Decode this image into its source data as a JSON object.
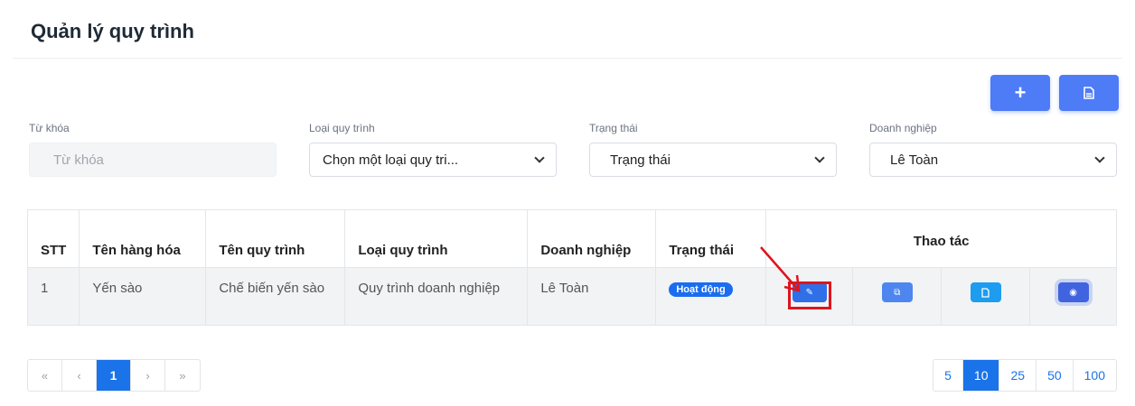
{
  "page": {
    "title": "Quản lý quy trình"
  },
  "actions": {
    "add_icon": "plus-icon",
    "export_icon": "document-icon"
  },
  "filters": {
    "keyword": {
      "label": "Từ khóa",
      "placeholder": "Từ khóa"
    },
    "process_type": {
      "label": "Loại quy trình",
      "value": "Chọn một loại quy tri..."
    },
    "status": {
      "label": "Trạng thái",
      "value": "Trạng thái"
    },
    "company": {
      "label": "Doanh nghiệp",
      "value": "Lê Toàn"
    }
  },
  "table": {
    "headers": {
      "index": "STT",
      "product": "Tên hàng hóa",
      "process_name": "Tên quy trình",
      "process_type": "Loại quy trình",
      "company": "Doanh nghiệp",
      "status": "Trạng thái",
      "actions": "Thao tác"
    },
    "rows": [
      {
        "index": "1",
        "product": "Yến sào",
        "process_name": "Chế biến yến sào",
        "process_type": "Quy trình doanh nghiệp",
        "company": "Lê Toàn",
        "status": "Hoạt động"
      }
    ]
  },
  "pagination": {
    "first": "«",
    "prev": "‹",
    "current": "1",
    "next": "›",
    "last": "»"
  },
  "page_sizes": [
    "5",
    "10",
    "25",
    "50",
    "100"
  ],
  "page_size_selected": "10",
  "colors": {
    "primary": "#1a73e8",
    "accent": "#4e7cf6",
    "highlight": "#e0141c"
  }
}
